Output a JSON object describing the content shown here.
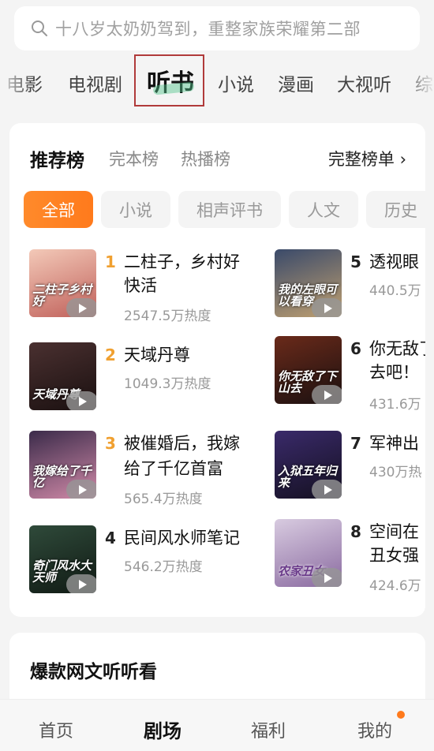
{
  "search": {
    "placeholder": "十八岁太奶奶驾到，重整家族荣耀第二部",
    "icon": "search-icon"
  },
  "categories": [
    {
      "label": "电影",
      "active": false
    },
    {
      "label": "电视剧",
      "active": false
    },
    {
      "label": "听书",
      "active": true
    },
    {
      "label": "小说",
      "active": false
    },
    {
      "label": "漫画",
      "active": false
    },
    {
      "label": "大视听",
      "active": false
    },
    {
      "label": "综",
      "active": false
    }
  ],
  "rank_tabs": [
    {
      "label": "推荐榜",
      "active": true
    },
    {
      "label": "完本榜",
      "active": false
    },
    {
      "label": "热播榜",
      "active": false
    }
  ],
  "full_list": {
    "label": "完整榜单 ›"
  },
  "chips": [
    {
      "label": "全部",
      "active": true
    },
    {
      "label": "小说",
      "active": false
    },
    {
      "label": "相声评书",
      "active": false
    },
    {
      "label": "人文",
      "active": false
    },
    {
      "label": "历史",
      "active": false
    }
  ],
  "items": [
    {
      "rank": "1",
      "title_lines": [
        "二柱子，乡村好",
        "快活"
      ],
      "heat": "2547.5万热度",
      "cover_text": "二柱子乡村好",
      "cover_colors": [
        "#f3c9b8",
        "#c0605a"
      ]
    },
    {
      "rank": "2",
      "title_lines": [
        "天域丹尊",
        ""
      ],
      "heat": "1049.3万热度",
      "cover_text": "天域丹尊",
      "cover_colors": [
        "#4a3030",
        "#1a1010"
      ]
    },
    {
      "rank": "3",
      "title_lines": [
        "被催婚后，我嫁",
        "给了千亿首富"
      ],
      "heat": "565.4万热度",
      "cover_text": "我嫁给了千亿",
      "cover_colors": [
        "#3b2b4a",
        "#d18aa8"
      ]
    },
    {
      "rank": "4",
      "title_lines": [
        "民间风水师笔记",
        ""
      ],
      "heat": "546.2万热度",
      "cover_text": "奇门风水大天师",
      "cover_colors": [
        "#2f4a3a",
        "#101a14"
      ]
    },
    {
      "rank": "5",
      "title_lines": [
        "透视眼",
        ""
      ],
      "heat": "440.5万",
      "cover_text": "我的左眼可以看穿",
      "cover_colors": [
        "#3a4a6a",
        "#c0a070"
      ]
    },
    {
      "rank": "6",
      "title_lines": [
        "你无敌了",
        "去吧！"
      ],
      "heat": "431.6万",
      "cover_text": "你无敌了下山去",
      "cover_colors": [
        "#6a2a1a",
        "#1a1010"
      ]
    },
    {
      "rank": "7",
      "title_lines": [
        "军神出",
        ""
      ],
      "heat": "430万热",
      "cover_text": "入狱五年归来",
      "cover_colors": [
        "#3a2a6a",
        "#141020"
      ]
    },
    {
      "rank": "8",
      "title_lines": [
        "空间在",
        "丑女强"
      ],
      "heat": "424.6万",
      "cover_text": "农家丑女",
      "cover_colors": [
        "#d8cbe0",
        "#8a6aa0"
      ]
    }
  ],
  "section2": {
    "title": "爆款网文听听看"
  },
  "bottom_nav": [
    {
      "label": "首页",
      "active": false
    },
    {
      "label": "剧场",
      "active": true
    },
    {
      "label": "福利",
      "active": false
    },
    {
      "label": "我的",
      "active": false
    }
  ],
  "colors": {
    "accent": "#ff7a1c",
    "rank_top": "#f0a030",
    "highlight_box": "#b03a3a"
  }
}
